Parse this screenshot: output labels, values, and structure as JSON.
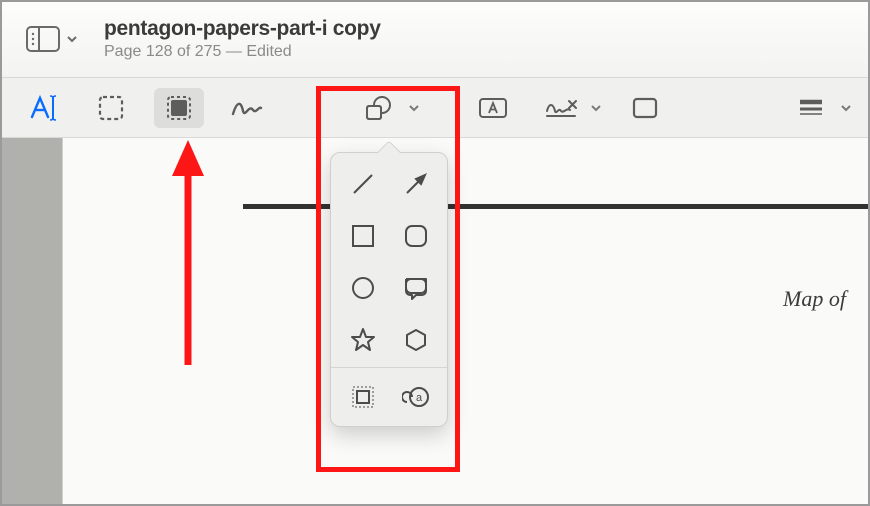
{
  "document": {
    "title": "pentagon-papers-part-i copy",
    "page_status": "Page 128 of 275 — Edited"
  },
  "toolbar": {
    "text_tool": "Text",
    "select_tool": "Rectangular Selection",
    "redact_tool": "Redact",
    "sketch_tool": "Sketch",
    "shapes_tool": "Shapes",
    "textbox_tool": "Text Box",
    "sign_tool": "Sign",
    "fill_tool": "Shape Style",
    "border_tool": "Border Color"
  },
  "shapes_menu": {
    "line": "Line",
    "arrow": "Arrow",
    "rect": "Rectangle",
    "roundrect": "Rounded Rectangle",
    "oval": "Oval",
    "speech": "Speech Bubble",
    "star": "Star",
    "hexagon": "Hexagon",
    "mask": "Mask",
    "loupe": "Loupe"
  },
  "page_content": {
    "caption_right": "Map of"
  }
}
